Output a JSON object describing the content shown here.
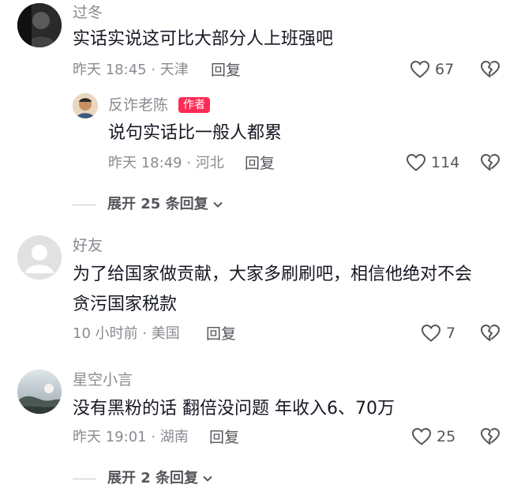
{
  "comments": [
    {
      "username": "过冬",
      "text": [
        "实话实说这可比大部分人上班强吧"
      ],
      "meta": "昨天 18:45 · 天津",
      "reply_label": "回复",
      "likes": "67",
      "reply": {
        "username": "反诈老陈",
        "badge": "作者",
        "text": "说句实话比一般人都累",
        "meta": "昨天 18:49 · 河北",
        "reply_label": "回复",
        "likes": "114"
      },
      "expand_label": "展开 25 条回复"
    },
    {
      "username": "好友",
      "text": [
        "为了给国家做贡献，大家多刷刷吧，相信他绝对不会",
        "贪污国家税款"
      ],
      "meta": "10 小时前 · 美国",
      "reply_label": "回复",
      "likes": "7"
    },
    {
      "username": "星空小言",
      "text": [
        "没有黑粉的话 翻倍没问题 年收入6、70万"
      ],
      "meta": "昨天 19:01 · 湖南",
      "reply_label": "回复",
      "likes": "25",
      "expand_label": "展开 2 条回复"
    }
  ],
  "colors": {
    "accent": "#fe2c55",
    "text_primary": "#161823",
    "text_secondary": "#8a8b91"
  },
  "icons": {
    "like": "heart-outline-icon",
    "dislike": "broken-heart-icon",
    "expand": "chevron-down-icon"
  }
}
